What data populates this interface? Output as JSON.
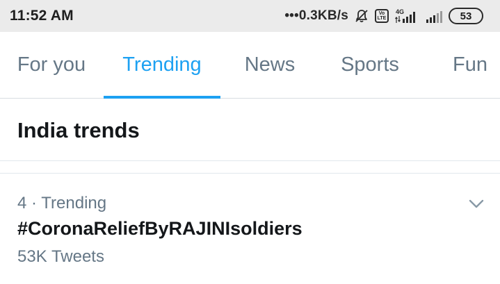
{
  "status_bar": {
    "time": "11:52 AM",
    "dots": "•••",
    "net_speed": "0.3KB/s",
    "volte_top": "Vo",
    "volte_bottom": "LTE",
    "network_type": "4G",
    "battery": "53",
    "icons": [
      "muted-bell-icon",
      "volte-icon",
      "signal-4g-icon",
      "signal-icon",
      "battery-icon"
    ]
  },
  "tabs": [
    {
      "label": "For you",
      "active": false
    },
    {
      "label": "Trending",
      "active": true
    },
    {
      "label": "News",
      "active": false
    },
    {
      "label": "Sports",
      "active": false
    },
    {
      "label": "Fun",
      "active": false
    }
  ],
  "section": {
    "title": "India trends"
  },
  "trends": [
    {
      "rank": "4",
      "separator": "·",
      "context": "Trending",
      "name": "#CoronaReliefByRAJINIsoldiers",
      "tweet_count": "53K Tweets",
      "caret_icon": "chevron-down-icon"
    }
  ],
  "colors": {
    "accent": "#1da1f2",
    "text_primary": "#14171a",
    "text_secondary": "#657786",
    "status_bar_bg": "#ebebeb",
    "divider": "#e1e8ed"
  }
}
